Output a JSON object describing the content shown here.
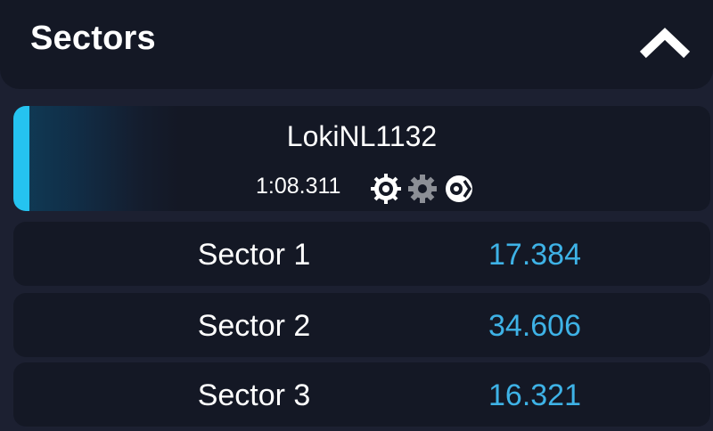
{
  "header": {
    "title": "Sectors",
    "toggle_icon": "chevron-up-icon"
  },
  "driver": {
    "name": "LokiNL1132",
    "lap_time": "1:08.311",
    "accent_color": "#25c3f0",
    "icons": [
      "tyre-icon",
      "gear-icon",
      "brake-assist-icon"
    ]
  },
  "sectors": [
    {
      "label": "Sector 1",
      "time": "17.384"
    },
    {
      "label": "Sector 2",
      "time": "34.606"
    },
    {
      "label": "Sector 3",
      "time": "16.321"
    }
  ],
  "colors": {
    "background": "#1c2031",
    "panel": "#141825",
    "sector_value": "#3eb2e6"
  }
}
